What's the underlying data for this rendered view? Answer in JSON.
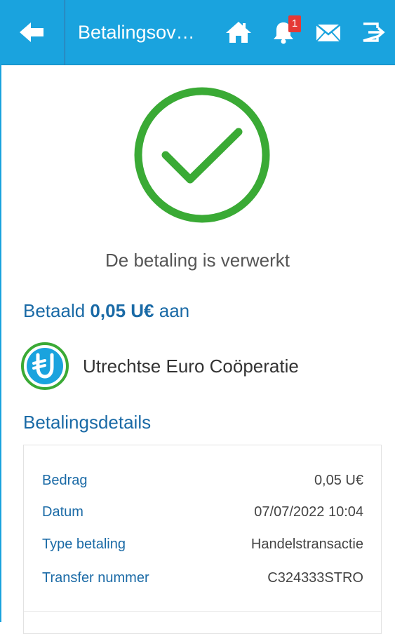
{
  "header": {
    "title": "Betalingsov…",
    "notification_count": "1",
    "icons": [
      "back-arrow-icon",
      "home-icon",
      "bell-icon",
      "mail-icon",
      "logout-icon"
    ],
    "background_color": "#1aa3de"
  },
  "status": {
    "message": "De betaling is verwerkt",
    "icon": "checkmark-circle-icon",
    "color": "#3aaa35"
  },
  "payment": {
    "prefix": "Betaald",
    "amount": "0,05 U€",
    "suffix": "aan",
    "recipient_name": "Utrechtse Euro Coöperatie",
    "recipient_avatar": "utrechtse-euro-logo"
  },
  "details": {
    "title": "Betalingsdetails",
    "rows": [
      {
        "label": "Bedrag",
        "value": "0,05 U€"
      },
      {
        "label": "Datum",
        "value": "07/07/2022 10:04"
      },
      {
        "label": "Type betaling",
        "value": "Handelstransactie"
      },
      {
        "label": "Transfer nummer",
        "value": "C324333STRO"
      }
    ]
  },
  "colors": {
    "accent_blue": "#1a6aa6",
    "success_green": "#3aaa35",
    "badge_red": "#e53935"
  }
}
